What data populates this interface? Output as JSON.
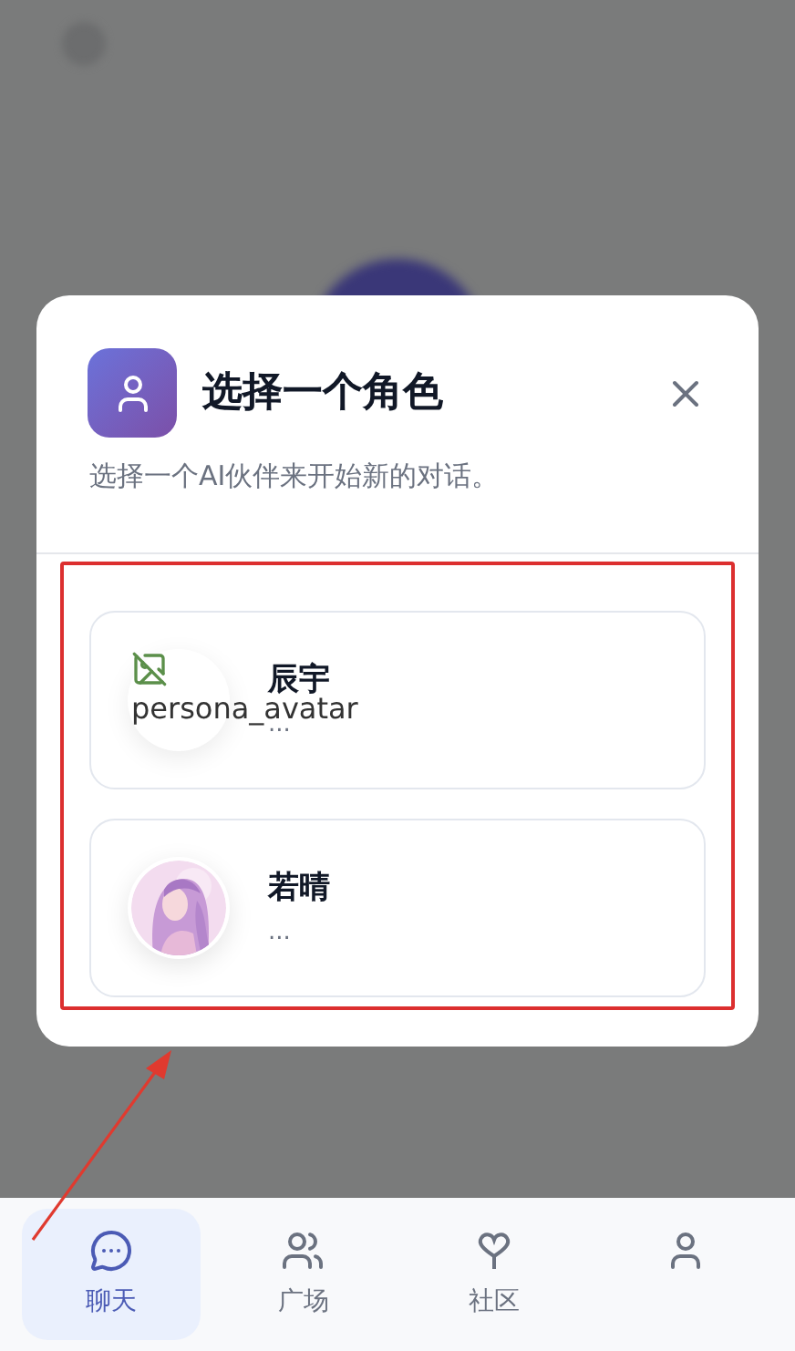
{
  "dialog": {
    "title": "选择一个角色",
    "subtitle": "选择一个AI伙伴来开始新的对话。",
    "personas": [
      {
        "name": "辰宇",
        "snippet": "...",
        "avatar": {
          "kind": "broken",
          "alt": "persona_avatar"
        }
      },
      {
        "name": "若晴",
        "snippet": "..."
      }
    ]
  },
  "nav": [
    {
      "label": "聊天",
      "kind": "chat",
      "selected": true
    },
    {
      "label": "广场",
      "kind": "group",
      "selected": false
    },
    {
      "label": "社区",
      "kind": "heart",
      "selected": false
    },
    {
      "kind": "user",
      "selected": false
    }
  ]
}
